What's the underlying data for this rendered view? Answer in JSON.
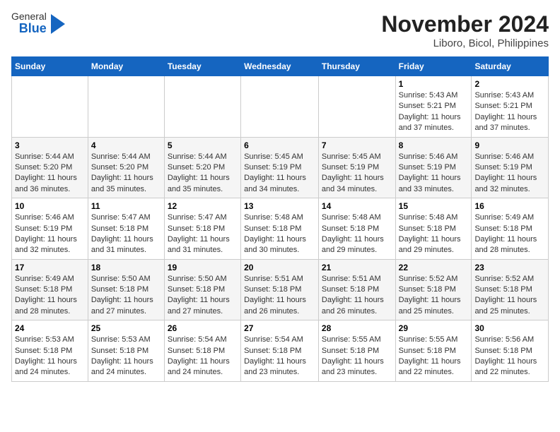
{
  "header": {
    "logo_general": "General",
    "logo_blue": "Blue",
    "title": "November 2024",
    "subtitle": "Liboro, Bicol, Philippines"
  },
  "calendar": {
    "columns": [
      "Sunday",
      "Monday",
      "Tuesday",
      "Wednesday",
      "Thursday",
      "Friday",
      "Saturday"
    ],
    "rows": [
      [
        {
          "day": "",
          "info": ""
        },
        {
          "day": "",
          "info": ""
        },
        {
          "day": "",
          "info": ""
        },
        {
          "day": "",
          "info": ""
        },
        {
          "day": "",
          "info": ""
        },
        {
          "day": "1",
          "info": "Sunrise: 5:43 AM\nSunset: 5:21 PM\nDaylight: 11 hours and 37 minutes."
        },
        {
          "day": "2",
          "info": "Sunrise: 5:43 AM\nSunset: 5:21 PM\nDaylight: 11 hours and 37 minutes."
        }
      ],
      [
        {
          "day": "3",
          "info": "Sunrise: 5:44 AM\nSunset: 5:20 PM\nDaylight: 11 hours and 36 minutes."
        },
        {
          "day": "4",
          "info": "Sunrise: 5:44 AM\nSunset: 5:20 PM\nDaylight: 11 hours and 35 minutes."
        },
        {
          "day": "5",
          "info": "Sunrise: 5:44 AM\nSunset: 5:20 PM\nDaylight: 11 hours and 35 minutes."
        },
        {
          "day": "6",
          "info": "Sunrise: 5:45 AM\nSunset: 5:19 PM\nDaylight: 11 hours and 34 minutes."
        },
        {
          "day": "7",
          "info": "Sunrise: 5:45 AM\nSunset: 5:19 PM\nDaylight: 11 hours and 34 minutes."
        },
        {
          "day": "8",
          "info": "Sunrise: 5:46 AM\nSunset: 5:19 PM\nDaylight: 11 hours and 33 minutes."
        },
        {
          "day": "9",
          "info": "Sunrise: 5:46 AM\nSunset: 5:19 PM\nDaylight: 11 hours and 32 minutes."
        }
      ],
      [
        {
          "day": "10",
          "info": "Sunrise: 5:46 AM\nSunset: 5:19 PM\nDaylight: 11 hours and 32 minutes."
        },
        {
          "day": "11",
          "info": "Sunrise: 5:47 AM\nSunset: 5:18 PM\nDaylight: 11 hours and 31 minutes."
        },
        {
          "day": "12",
          "info": "Sunrise: 5:47 AM\nSunset: 5:18 PM\nDaylight: 11 hours and 31 minutes."
        },
        {
          "day": "13",
          "info": "Sunrise: 5:48 AM\nSunset: 5:18 PM\nDaylight: 11 hours and 30 minutes."
        },
        {
          "day": "14",
          "info": "Sunrise: 5:48 AM\nSunset: 5:18 PM\nDaylight: 11 hours and 29 minutes."
        },
        {
          "day": "15",
          "info": "Sunrise: 5:48 AM\nSunset: 5:18 PM\nDaylight: 11 hours and 29 minutes."
        },
        {
          "day": "16",
          "info": "Sunrise: 5:49 AM\nSunset: 5:18 PM\nDaylight: 11 hours and 28 minutes."
        }
      ],
      [
        {
          "day": "17",
          "info": "Sunrise: 5:49 AM\nSunset: 5:18 PM\nDaylight: 11 hours and 28 minutes."
        },
        {
          "day": "18",
          "info": "Sunrise: 5:50 AM\nSunset: 5:18 PM\nDaylight: 11 hours and 27 minutes."
        },
        {
          "day": "19",
          "info": "Sunrise: 5:50 AM\nSunset: 5:18 PM\nDaylight: 11 hours and 27 minutes."
        },
        {
          "day": "20",
          "info": "Sunrise: 5:51 AM\nSunset: 5:18 PM\nDaylight: 11 hours and 26 minutes."
        },
        {
          "day": "21",
          "info": "Sunrise: 5:51 AM\nSunset: 5:18 PM\nDaylight: 11 hours and 26 minutes."
        },
        {
          "day": "22",
          "info": "Sunrise: 5:52 AM\nSunset: 5:18 PM\nDaylight: 11 hours and 25 minutes."
        },
        {
          "day": "23",
          "info": "Sunrise: 5:52 AM\nSunset: 5:18 PM\nDaylight: 11 hours and 25 minutes."
        }
      ],
      [
        {
          "day": "24",
          "info": "Sunrise: 5:53 AM\nSunset: 5:18 PM\nDaylight: 11 hours and 24 minutes."
        },
        {
          "day": "25",
          "info": "Sunrise: 5:53 AM\nSunset: 5:18 PM\nDaylight: 11 hours and 24 minutes."
        },
        {
          "day": "26",
          "info": "Sunrise: 5:54 AM\nSunset: 5:18 PM\nDaylight: 11 hours and 24 minutes."
        },
        {
          "day": "27",
          "info": "Sunrise: 5:54 AM\nSunset: 5:18 PM\nDaylight: 11 hours and 23 minutes."
        },
        {
          "day": "28",
          "info": "Sunrise: 5:55 AM\nSunset: 5:18 PM\nDaylight: 11 hours and 23 minutes."
        },
        {
          "day": "29",
          "info": "Sunrise: 5:55 AM\nSunset: 5:18 PM\nDaylight: 11 hours and 22 minutes."
        },
        {
          "day": "30",
          "info": "Sunrise: 5:56 AM\nSunset: 5:18 PM\nDaylight: 11 hours and 22 minutes."
        }
      ]
    ]
  }
}
